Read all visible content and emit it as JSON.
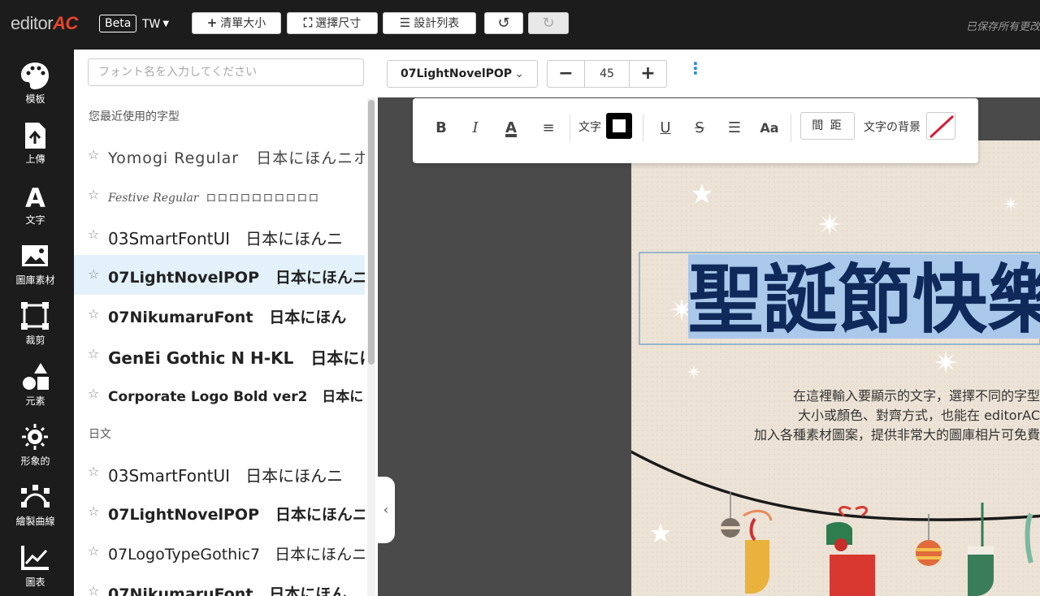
{
  "topbar": {
    "logo_main": "editor",
    "logo_accent": "AC",
    "beta": "Beta",
    "lang": "TW",
    "buttons": {
      "resize": "清單大小",
      "select_size": "選擇尺寸",
      "design_list": "設計列表"
    },
    "saved_status": "已保存所有更改"
  },
  "sidebar": {
    "items": [
      {
        "label": "模板",
        "icon": "palette-icon"
      },
      {
        "label": "上傳",
        "icon": "upload-icon"
      },
      {
        "label": "文字",
        "icon": "text-icon"
      },
      {
        "label": "圖庫素材",
        "icon": "image-icon"
      },
      {
        "label": "裁剪",
        "icon": "crop-icon"
      },
      {
        "label": "元素",
        "icon": "shapes-icon"
      },
      {
        "label": "形象的",
        "icon": "sun-icon"
      },
      {
        "label": "繪製曲線",
        "icon": "curve-icon"
      },
      {
        "label": "圖表",
        "icon": "chart-icon"
      }
    ]
  },
  "fontpanel": {
    "search_placeholder": "フォント名を入力してください",
    "recent_heading": "您最近使用的字型",
    "recent": [
      {
        "name": "Yomogi Regular",
        "sample": "日本にほんニホン"
      },
      {
        "name": "Festive Regular",
        "sample": "ロロロロロロロロロロ"
      },
      {
        "name": "03SmartFontUI",
        "sample": "日本にほんニ"
      },
      {
        "name": "07LightNovelPOP",
        "sample": "日本にほんニホ"
      },
      {
        "name": "07NikumaruFont",
        "sample": "日本にほん"
      },
      {
        "name": "GenEi Gothic N H-KL",
        "sample": "日本にに"
      },
      {
        "name": "Corporate Logo Bold ver2",
        "sample": "日本に"
      }
    ],
    "japanese_heading": "日文",
    "japanese": [
      {
        "name": "03SmartFontUI",
        "sample": "日本にほんニ"
      },
      {
        "name": "07LightNovelPOP",
        "sample": "日本にほんニホ"
      },
      {
        "name": "07LogoTypeGothic7",
        "sample": "日本にほんニホ"
      },
      {
        "name": "07NikumaruFont",
        "sample": "日本にほん"
      }
    ]
  },
  "fonttoolbar": {
    "font": "07LightNovelPOP",
    "size": "45"
  },
  "formatbar": {
    "text_label": "文字",
    "spacing_label": "間 距",
    "bg_label": "文字の背景"
  },
  "canvas": {
    "title": "聖誕節快樂",
    "body_lines": [
      "在這裡輸入要顯示的文字，選擇不同的字型",
      "大小或顏色、對齊方式，也能在 editorAC",
      "加入各種素材圖案，提供非常大的圖庫相片可免費"
    ]
  },
  "colors": {
    "title_text": "#0f2a5a",
    "accent": "#e8452c",
    "selected_row": "#e3f1fb"
  }
}
